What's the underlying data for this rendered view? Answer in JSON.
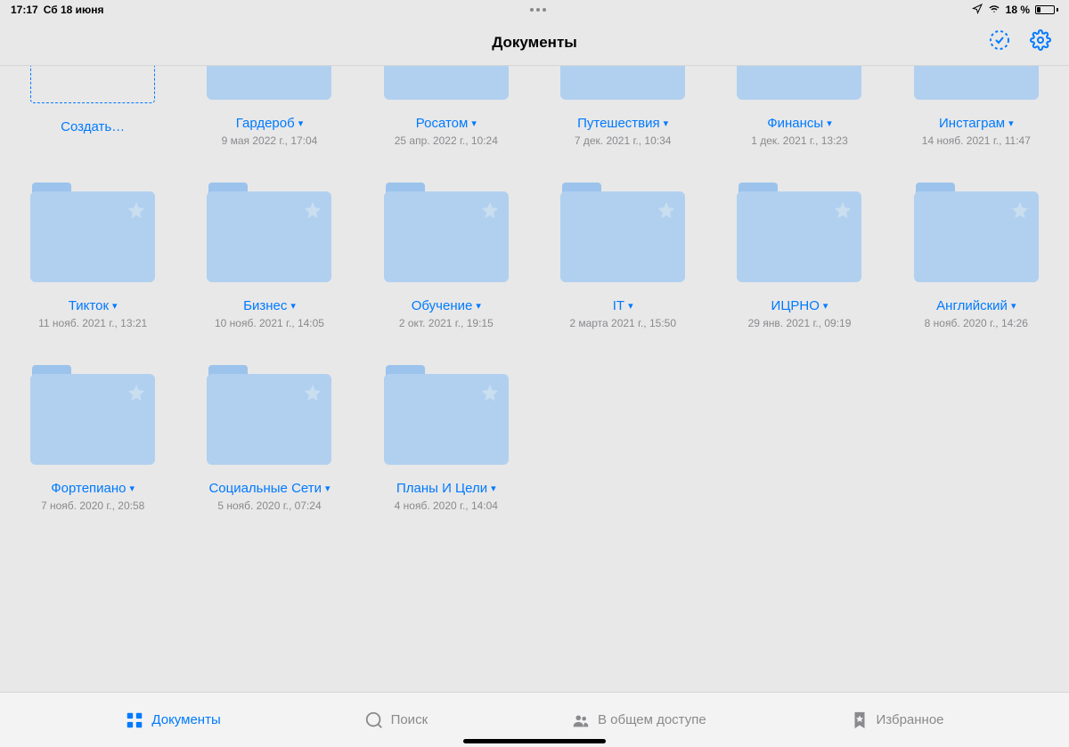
{
  "status": {
    "time": "17:17",
    "date": "Сб 18 июня",
    "battery_pct": "18 %"
  },
  "header": {
    "title": "Документы"
  },
  "create_label": "Создать…",
  "folders": [
    {
      "name": "Гардероб",
      "date": "9 мая 2022 г., 17:04",
      "partial": true
    },
    {
      "name": "Росатом",
      "date": "25 апр. 2022 г., 10:24",
      "partial": true
    },
    {
      "name": "Путешествия",
      "date": "7 дек. 2021 г., 10:34",
      "partial": true
    },
    {
      "name": "Финансы",
      "date": "1 дек. 2021 г., 13:23",
      "partial": true
    },
    {
      "name": "Инстаграм",
      "date": "14 нояб. 2021 г., 11:47",
      "partial": true
    },
    {
      "name": "Тикток",
      "date": "11 нояб. 2021 г., 13:21"
    },
    {
      "name": "Бизнес",
      "date": "10 нояб. 2021 г., 14:05"
    },
    {
      "name": "Обучение",
      "date": "2 окт. 2021 г., 19:15"
    },
    {
      "name": "IT",
      "date": "2 марта 2021 г., 15:50"
    },
    {
      "name": "ИЦРНО",
      "date": "29 янв. 2021 г., 09:19"
    },
    {
      "name": "Английский",
      "date": "8 нояб. 2020 г., 14:26"
    },
    {
      "name": "Фортепиано",
      "date": "7 нояб. 2020 г., 20:58"
    },
    {
      "name": "Социальные Сети",
      "date": "5 нояб. 2020 г., 07:24"
    },
    {
      "name": "Планы И Цели",
      "date": "4 нояб. 2020 г., 14:04"
    }
  ],
  "tabs": {
    "documents": "Документы",
    "search": "Поиск",
    "shared": "В общем доступе",
    "favorites": "Избранное"
  }
}
